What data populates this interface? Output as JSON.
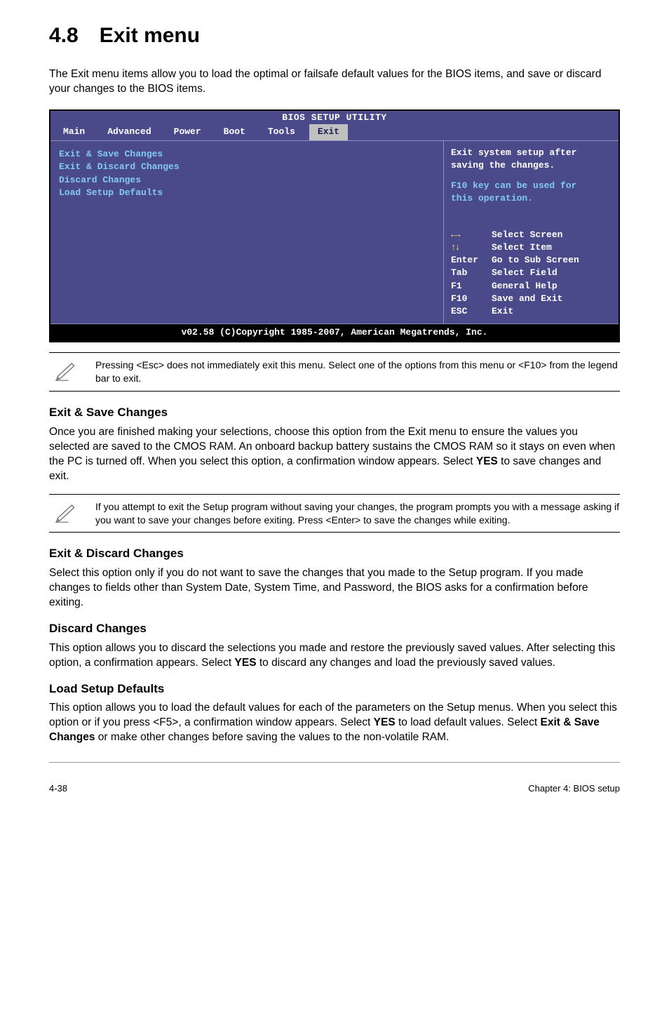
{
  "heading": {
    "number": "4.8",
    "title": "Exit menu"
  },
  "intro": "The Exit menu items allow you to load the optimal or failsafe default values for the BIOS items, and save or discard your changes to the BIOS items.",
  "bios": {
    "title": "BIOS SETUP UTILITY",
    "tabs": [
      "Main",
      "Advanced",
      "Power",
      "Boot",
      "Tools",
      "Exit"
    ],
    "active_tab": "Exit",
    "left_items": [
      "Exit & Save Changes",
      "Exit & Discard Changes",
      "Discard Changes",
      "",
      "Load Setup Defaults"
    ],
    "right_top": {
      "line1": "Exit system setup after",
      "line2": "saving the changes.",
      "line3": "F10 key can be used for",
      "line4": "this operation."
    },
    "right_bottom": [
      {
        "key": "←→",
        "label": "Select Screen"
      },
      {
        "key": "↑↓",
        "label": "Select Item"
      },
      {
        "key": "Enter",
        "label": "Go to Sub Screen"
      },
      {
        "key": "Tab",
        "label": "Select Field"
      },
      {
        "key": "F1",
        "label": "General Help"
      },
      {
        "key": "F10",
        "label": "Save and Exit"
      },
      {
        "key": "ESC",
        "label": "Exit"
      }
    ],
    "footer": "v02.58 (C)Copyright 1985-2007, American Megatrends, Inc."
  },
  "note1": "Pressing <Esc> does not immediately exit this menu. Select one of the options from this menu or <F10> from the legend bar to exit.",
  "sections": {
    "s1": {
      "head": "Exit & Save Changes",
      "body": "Once you are finished making your selections, choose this option from the Exit menu to ensure the values you selected are saved to the CMOS RAM. An onboard backup battery sustains the CMOS RAM so it stays on even when the PC is turned off. When you select this option, a confirmation window appears. Select YES to save changes and exit."
    },
    "note2": "If you attempt to exit the Setup program without saving your changes, the program prompts you with a message asking if you want to save your changes before exiting. Press <Enter> to save the changes while exiting.",
    "s2": {
      "head": "Exit & Discard Changes",
      "body": "Select this option only if you do not want to save the changes that you  made to the Setup program. If you made changes to fields other than System Date, System Time, and Password, the BIOS asks for a confirmation before exiting."
    },
    "s3": {
      "head": "Discard Changes",
      "body": "This option allows you to discard the selections you made and restore the previously saved values. After selecting this option, a confirmation appears. Select YES to discard any changes and load the previously saved values."
    },
    "s4": {
      "head": "Load Setup Defaults",
      "body": "This option allows you to load the default values for each of the parameters on the Setup menus. When you select this option or if you press <F5>, a confirmation window appears. Select YES to load default values. Select Exit & Save Changes or make other changes before saving the values to the non-volatile RAM."
    }
  },
  "footer": {
    "left": "4-38",
    "right": "Chapter 4: BIOS setup"
  },
  "chart_data": null
}
